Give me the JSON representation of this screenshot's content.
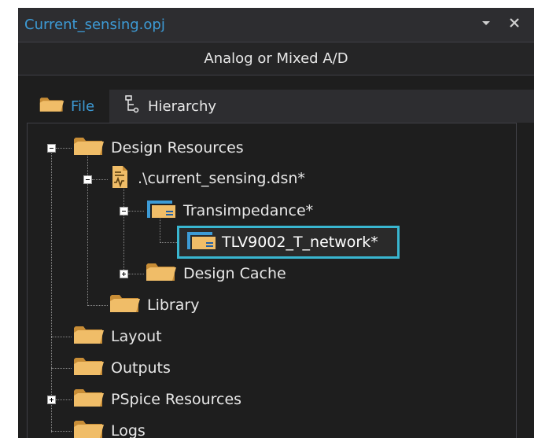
{
  "window": {
    "title": "Current_sensing.opj",
    "menu_icon": "chevron-down-icon",
    "close_icon": "close-icon"
  },
  "project_type": "Analog or Mixed A/D",
  "tabs": [
    {
      "label": "File",
      "icon": "folder-icon",
      "active": true
    },
    {
      "label": "Hierarchy",
      "icon": "hierarchy-icon",
      "active": false
    }
  ],
  "tree": {
    "design_resources": "Design Resources",
    "design_file": ".\\current_sensing.dsn*",
    "schematic": "Transimpedance*",
    "page": "TLV9002_T_network*",
    "design_cache": "Design Cache",
    "library": "Library",
    "layout": "Layout",
    "outputs": "Outputs",
    "pspice_resources": "PSpice Resources",
    "logs": "Logs"
  },
  "colors": {
    "accent": "#3d9bd6",
    "selection": "#39b6d0",
    "folder": "#e9b35b"
  }
}
